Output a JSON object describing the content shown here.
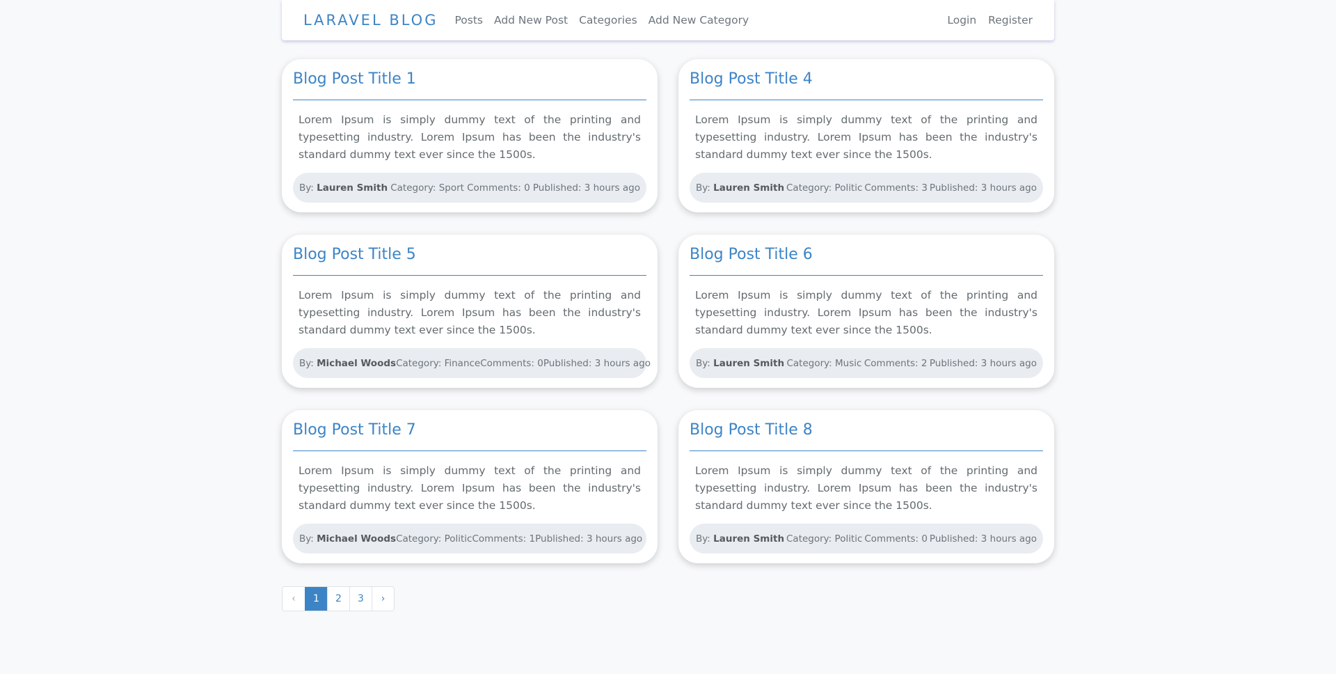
{
  "navbar": {
    "brand": "LARAVEL BLOG",
    "links": [
      "Posts",
      "Add New Post",
      "Categories",
      "Add New Category"
    ],
    "auth": [
      "Login",
      "Register"
    ]
  },
  "meta_labels": {
    "by": "By:",
    "category": "Category:",
    "comments": "Comments:",
    "published": "Published:"
  },
  "posts": [
    {
      "title": "Blog Post Title 1",
      "body": "Lorem Ipsum is simply dummy text of the printing and typesetting industry. Lorem Ipsum has been the industry's standard dummy text ever since the 1500s.",
      "author": "Lauren Smith",
      "category": "Sport",
      "comments": "0",
      "published": "3 hours ago"
    },
    {
      "title": "Blog Post Title 4",
      "body": "Lorem Ipsum is simply dummy text of the printing and typesetting industry. Lorem Ipsum has been the industry's standard dummy text ever since the 1500s.",
      "author": "Lauren Smith",
      "category": "Politic",
      "comments": "3",
      "published": "3 hours ago"
    },
    {
      "title": "Blog Post Title 5",
      "body": "Lorem Ipsum is simply dummy text of the printing and typesetting industry. Lorem Ipsum has been the industry's standard dummy text ever since the 1500s.",
      "author": "Michael Woods",
      "category": "Finance",
      "comments": "0",
      "published": "3 hours ago"
    },
    {
      "title": "Blog Post Title 6",
      "body": "Lorem Ipsum is simply dummy text of the printing and typesetting industry. Lorem Ipsum has been the industry's standard dummy text ever since the 1500s.",
      "author": "Lauren Smith",
      "category": "Music",
      "comments": "2",
      "published": "3 hours ago"
    },
    {
      "title": "Blog Post Title 7",
      "body": "Lorem Ipsum is simply dummy text of the printing and typesetting industry. Lorem Ipsum has been the industry's standard dummy text ever since the 1500s.",
      "author": "Michael Woods",
      "category": "Politic",
      "comments": "1",
      "published": "3 hours ago"
    },
    {
      "title": "Blog Post Title 8",
      "body": "Lorem Ipsum is simply dummy text of the printing and typesetting industry. Lorem Ipsum has been the industry's standard dummy text ever since the 1500s.",
      "author": "Lauren Smith",
      "category": "Politic",
      "comments": "0",
      "published": "3 hours ago"
    }
  ],
  "pagination": {
    "prev": "‹",
    "pages": [
      "1",
      "2",
      "3"
    ],
    "current": "1",
    "next": "›"
  },
  "colors": {
    "accent": "#3d84c6",
    "background": "#f8f9fb",
    "meta_background": "#e9ecf0"
  }
}
